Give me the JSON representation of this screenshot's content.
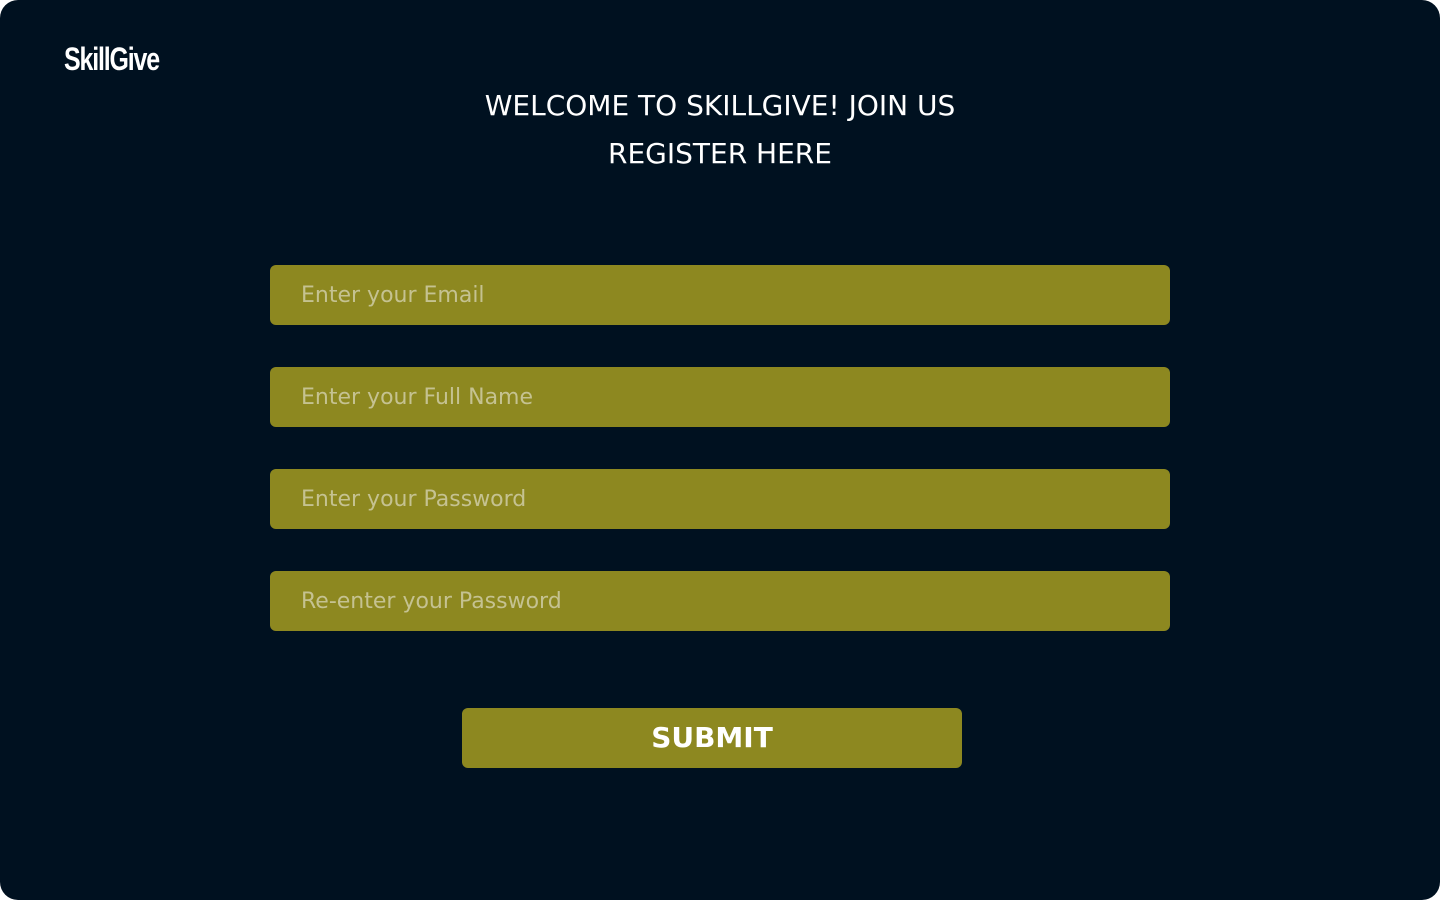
{
  "app": {
    "logo_text": "SkillGive"
  },
  "header": {
    "title_line1": "WELCOME TO SKILLGIVE! JOIN US",
    "title_line2": "REGISTER HERE"
  },
  "form": {
    "fields": [
      {
        "name": "email",
        "placeholder": "Enter your Email",
        "value": ""
      },
      {
        "name": "full_name",
        "placeholder": "Enter your Full Name",
        "value": ""
      },
      {
        "name": "password",
        "placeholder": "Enter your Password",
        "value": ""
      },
      {
        "name": "confirm_password",
        "placeholder": "Re-enter your Password",
        "value": ""
      }
    ],
    "submit_label": "SUBMIT"
  },
  "colors": {
    "background": "#001120",
    "accent": "#8d8820",
    "text": "#ffffff",
    "placeholder": "#c5c291"
  }
}
